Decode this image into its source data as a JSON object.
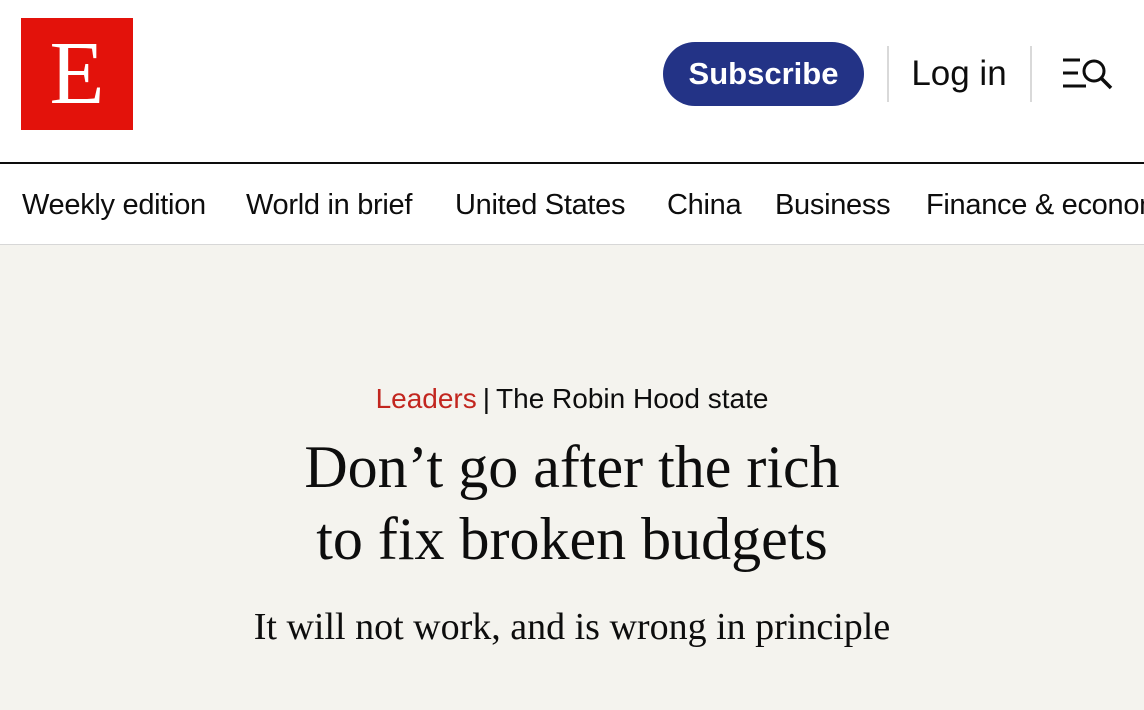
{
  "brand": {
    "logo_letter": "E",
    "logo_color": "#e3120b"
  },
  "header": {
    "subscribe_label": "Subscribe",
    "subscribe_color": "#233386",
    "login_label": "Log in",
    "menu_icon": "menu-search-icon"
  },
  "nav": {
    "items": [
      {
        "label": "Weekly edition"
      },
      {
        "label": "World in brief"
      },
      {
        "label": "United States"
      },
      {
        "label": "China"
      },
      {
        "label": "Business"
      },
      {
        "label": "Finance & economics"
      }
    ]
  },
  "article": {
    "section": "Leaders",
    "separator": "|",
    "fly_title": "The Robin Hood state",
    "headline_line1": "Don’t go after the rich",
    "headline_line2": "to fix broken budgets",
    "rubric": "It will not work, and is wrong in principle",
    "section_color": "#c2261f",
    "background_color": "#f4f3ee"
  }
}
